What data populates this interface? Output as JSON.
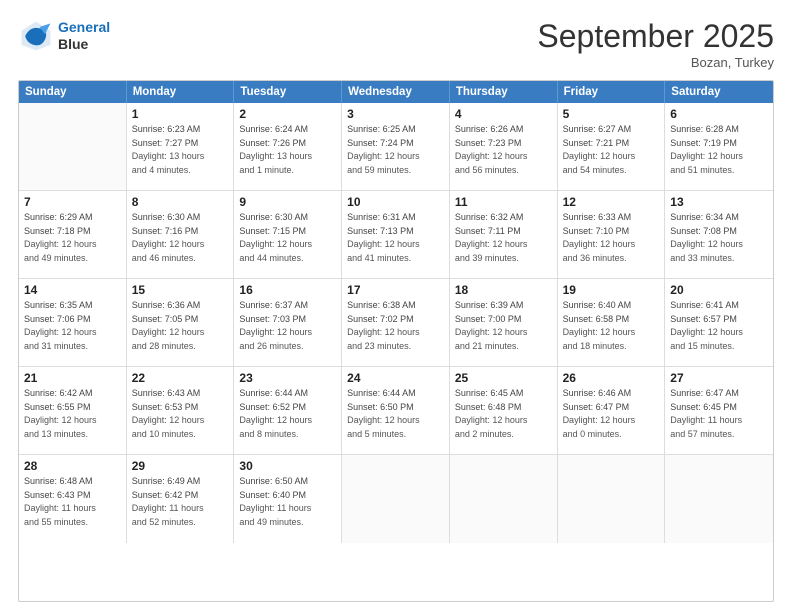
{
  "header": {
    "logo_line1": "General",
    "logo_line2": "Blue",
    "month": "September 2025",
    "location": "Bozan, Turkey"
  },
  "weekdays": [
    "Sunday",
    "Monday",
    "Tuesday",
    "Wednesday",
    "Thursday",
    "Friday",
    "Saturday"
  ],
  "weeks": [
    [
      {
        "day": "",
        "sunrise": "",
        "sunset": "",
        "daylight": ""
      },
      {
        "day": "1",
        "sunrise": "Sunrise: 6:23 AM",
        "sunset": "Sunset: 7:27 PM",
        "daylight": "Daylight: 13 hours and 4 minutes."
      },
      {
        "day": "2",
        "sunrise": "Sunrise: 6:24 AM",
        "sunset": "Sunset: 7:26 PM",
        "daylight": "Daylight: 13 hours and 1 minute."
      },
      {
        "day": "3",
        "sunrise": "Sunrise: 6:25 AM",
        "sunset": "Sunset: 7:24 PM",
        "daylight": "Daylight: 12 hours and 59 minutes."
      },
      {
        "day": "4",
        "sunrise": "Sunrise: 6:26 AM",
        "sunset": "Sunset: 7:23 PM",
        "daylight": "Daylight: 12 hours and 56 minutes."
      },
      {
        "day": "5",
        "sunrise": "Sunrise: 6:27 AM",
        "sunset": "Sunset: 7:21 PM",
        "daylight": "Daylight: 12 hours and 54 minutes."
      },
      {
        "day": "6",
        "sunrise": "Sunrise: 6:28 AM",
        "sunset": "Sunset: 7:19 PM",
        "daylight": "Daylight: 12 hours and 51 minutes."
      }
    ],
    [
      {
        "day": "7",
        "sunrise": "Sunrise: 6:29 AM",
        "sunset": "Sunset: 7:18 PM",
        "daylight": "Daylight: 12 hours and 49 minutes."
      },
      {
        "day": "8",
        "sunrise": "Sunrise: 6:30 AM",
        "sunset": "Sunset: 7:16 PM",
        "daylight": "Daylight: 12 hours and 46 minutes."
      },
      {
        "day": "9",
        "sunrise": "Sunrise: 6:30 AM",
        "sunset": "Sunset: 7:15 PM",
        "daylight": "Daylight: 12 hours and 44 minutes."
      },
      {
        "day": "10",
        "sunrise": "Sunrise: 6:31 AM",
        "sunset": "Sunset: 7:13 PM",
        "daylight": "Daylight: 12 hours and 41 minutes."
      },
      {
        "day": "11",
        "sunrise": "Sunrise: 6:32 AM",
        "sunset": "Sunset: 7:11 PM",
        "daylight": "Daylight: 12 hours and 39 minutes."
      },
      {
        "day": "12",
        "sunrise": "Sunrise: 6:33 AM",
        "sunset": "Sunset: 7:10 PM",
        "daylight": "Daylight: 12 hours and 36 minutes."
      },
      {
        "day": "13",
        "sunrise": "Sunrise: 6:34 AM",
        "sunset": "Sunset: 7:08 PM",
        "daylight": "Daylight: 12 hours and 33 minutes."
      }
    ],
    [
      {
        "day": "14",
        "sunrise": "Sunrise: 6:35 AM",
        "sunset": "Sunset: 7:06 PM",
        "daylight": "Daylight: 12 hours and 31 minutes."
      },
      {
        "day": "15",
        "sunrise": "Sunrise: 6:36 AM",
        "sunset": "Sunset: 7:05 PM",
        "daylight": "Daylight: 12 hours and 28 minutes."
      },
      {
        "day": "16",
        "sunrise": "Sunrise: 6:37 AM",
        "sunset": "Sunset: 7:03 PM",
        "daylight": "Daylight: 12 hours and 26 minutes."
      },
      {
        "day": "17",
        "sunrise": "Sunrise: 6:38 AM",
        "sunset": "Sunset: 7:02 PM",
        "daylight": "Daylight: 12 hours and 23 minutes."
      },
      {
        "day": "18",
        "sunrise": "Sunrise: 6:39 AM",
        "sunset": "Sunset: 7:00 PM",
        "daylight": "Daylight: 12 hours and 21 minutes."
      },
      {
        "day": "19",
        "sunrise": "Sunrise: 6:40 AM",
        "sunset": "Sunset: 6:58 PM",
        "daylight": "Daylight: 12 hours and 18 minutes."
      },
      {
        "day": "20",
        "sunrise": "Sunrise: 6:41 AM",
        "sunset": "Sunset: 6:57 PM",
        "daylight": "Daylight: 12 hours and 15 minutes."
      }
    ],
    [
      {
        "day": "21",
        "sunrise": "Sunrise: 6:42 AM",
        "sunset": "Sunset: 6:55 PM",
        "daylight": "Daylight: 12 hours and 13 minutes."
      },
      {
        "day": "22",
        "sunrise": "Sunrise: 6:43 AM",
        "sunset": "Sunset: 6:53 PM",
        "daylight": "Daylight: 12 hours and 10 minutes."
      },
      {
        "day": "23",
        "sunrise": "Sunrise: 6:44 AM",
        "sunset": "Sunset: 6:52 PM",
        "daylight": "Daylight: 12 hours and 8 minutes."
      },
      {
        "day": "24",
        "sunrise": "Sunrise: 6:44 AM",
        "sunset": "Sunset: 6:50 PM",
        "daylight": "Daylight: 12 hours and 5 minutes."
      },
      {
        "day": "25",
        "sunrise": "Sunrise: 6:45 AM",
        "sunset": "Sunset: 6:48 PM",
        "daylight": "Daylight: 12 hours and 2 minutes."
      },
      {
        "day": "26",
        "sunrise": "Sunrise: 6:46 AM",
        "sunset": "Sunset: 6:47 PM",
        "daylight": "Daylight: 12 hours and 0 minutes."
      },
      {
        "day": "27",
        "sunrise": "Sunrise: 6:47 AM",
        "sunset": "Sunset: 6:45 PM",
        "daylight": "Daylight: 11 hours and 57 minutes."
      }
    ],
    [
      {
        "day": "28",
        "sunrise": "Sunrise: 6:48 AM",
        "sunset": "Sunset: 6:43 PM",
        "daylight": "Daylight: 11 hours and 55 minutes."
      },
      {
        "day": "29",
        "sunrise": "Sunrise: 6:49 AM",
        "sunset": "Sunset: 6:42 PM",
        "daylight": "Daylight: 11 hours and 52 minutes."
      },
      {
        "day": "30",
        "sunrise": "Sunrise: 6:50 AM",
        "sunset": "Sunset: 6:40 PM",
        "daylight": "Daylight: 11 hours and 49 minutes."
      },
      {
        "day": "",
        "sunrise": "",
        "sunset": "",
        "daylight": ""
      },
      {
        "day": "",
        "sunrise": "",
        "sunset": "",
        "daylight": ""
      },
      {
        "day": "",
        "sunrise": "",
        "sunset": "",
        "daylight": ""
      },
      {
        "day": "",
        "sunrise": "",
        "sunset": "",
        "daylight": ""
      }
    ]
  ]
}
